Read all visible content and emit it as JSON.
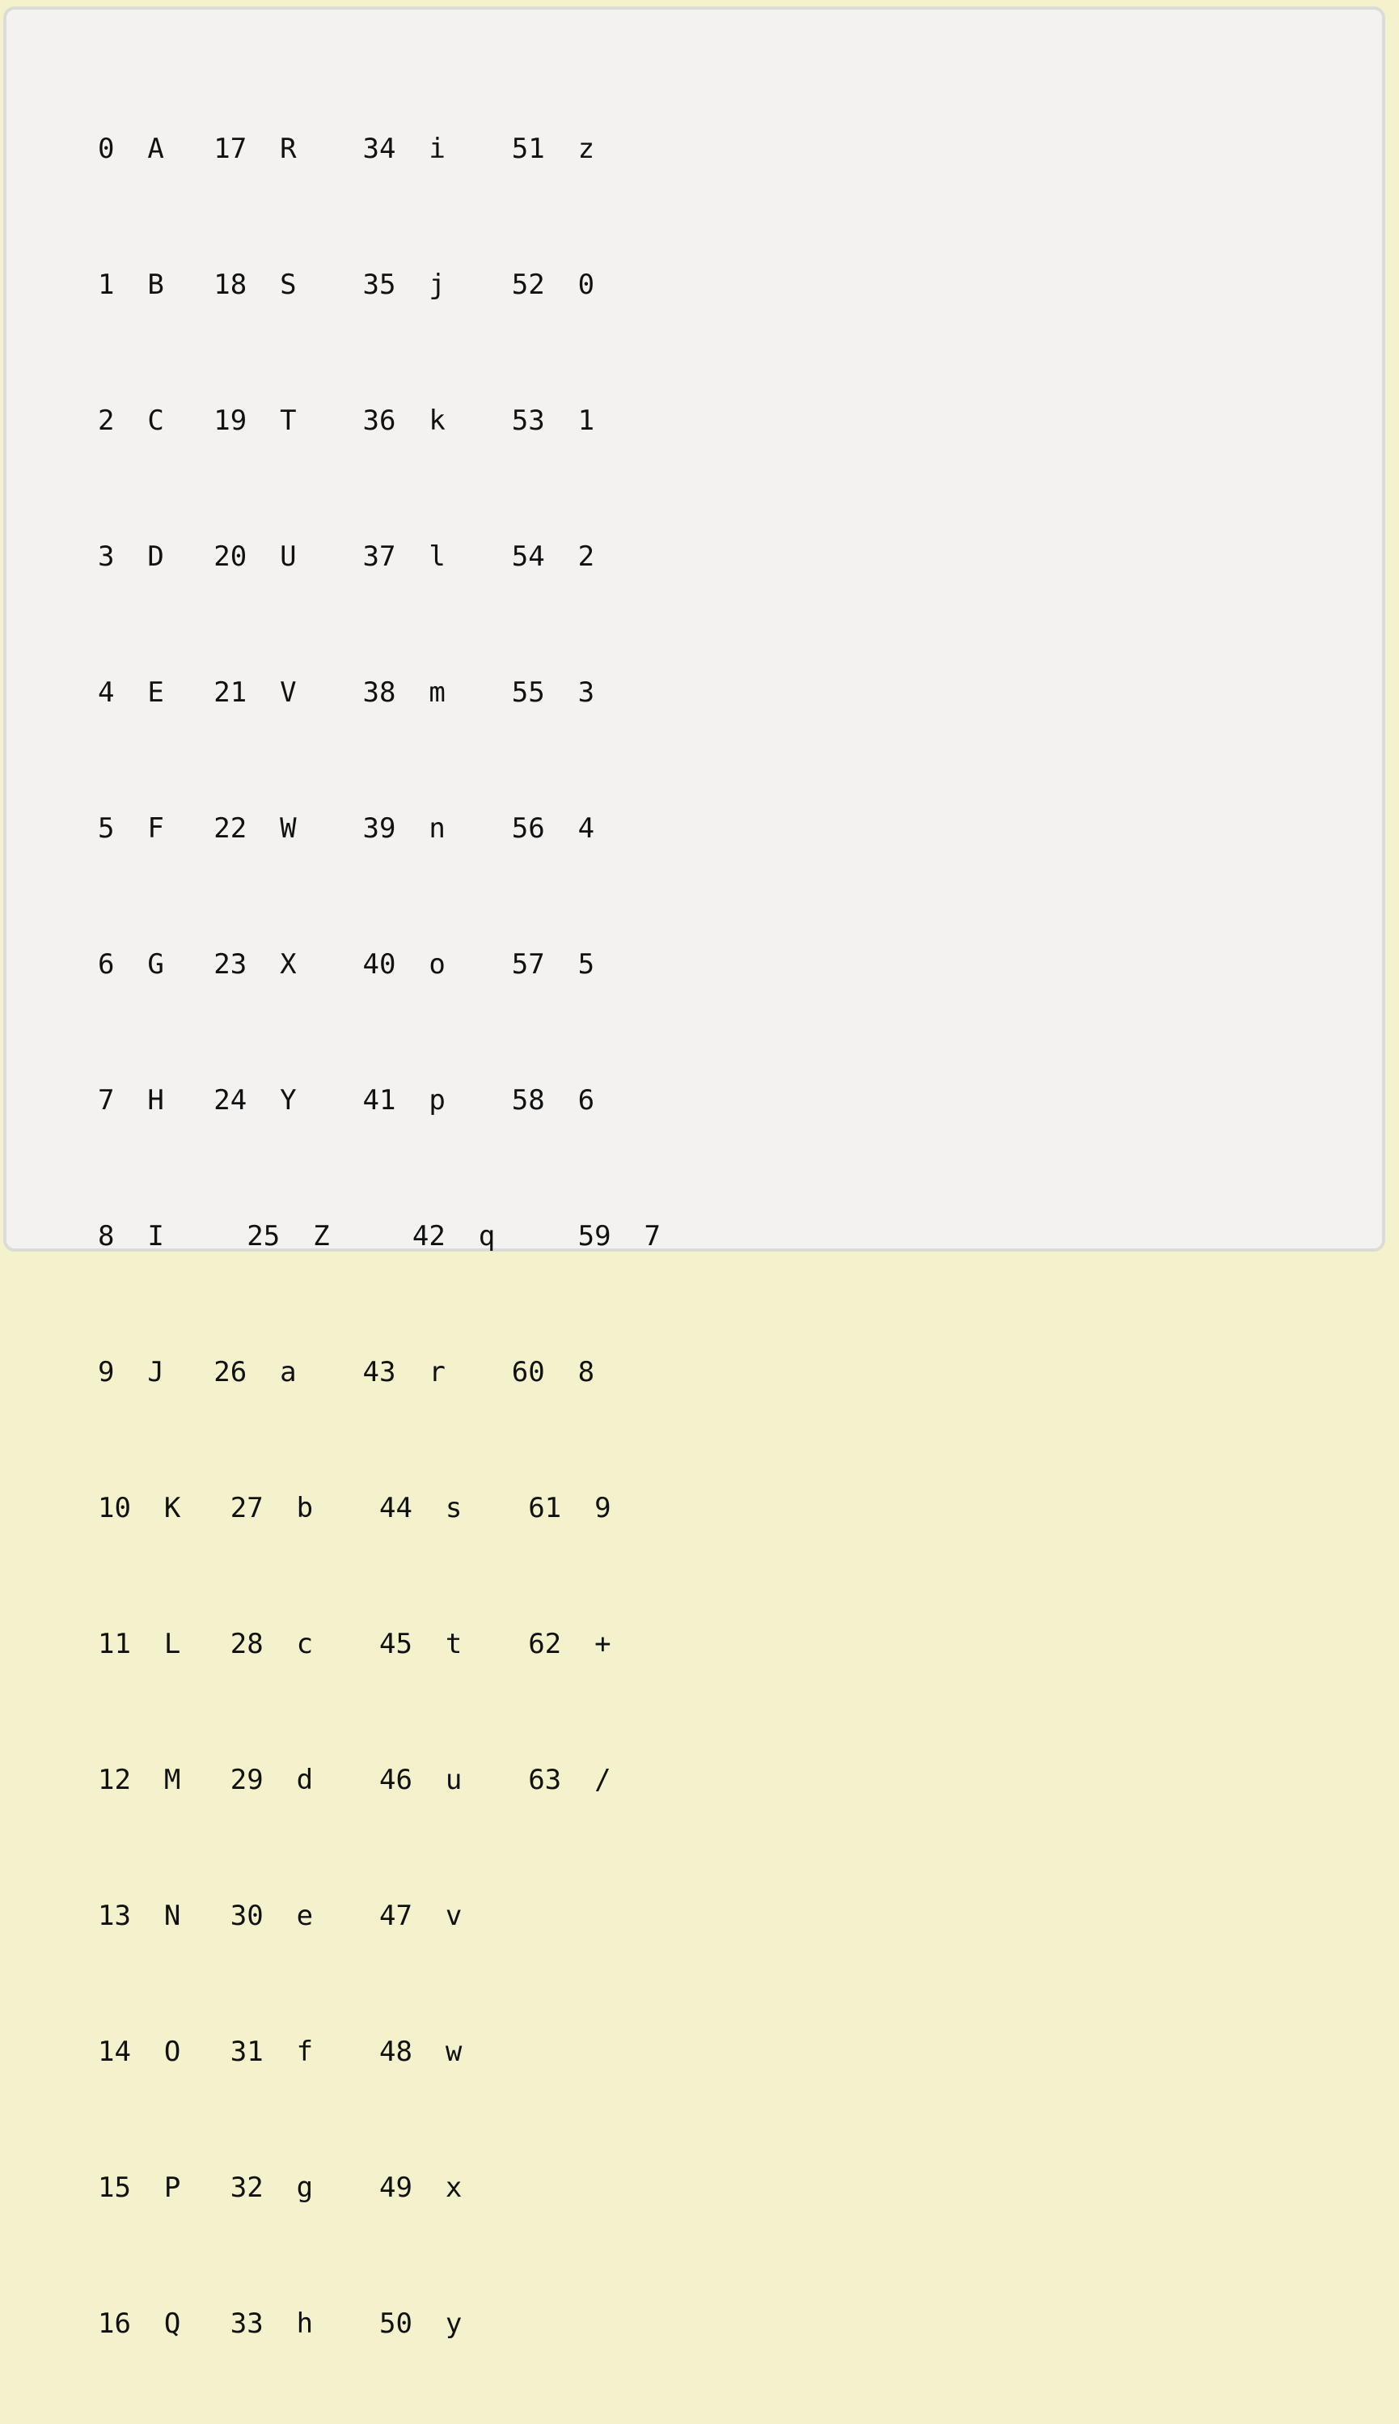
{
  "table": {
    "lines": [
      "0  A   17  R    34  i    51  z",
      "1  B   18  S    35  j    52  0",
      "2  C   19  T    36  k    53  1",
      "3  D   20  U    37  l    54  2",
      "4  E   21  V    38  m    55  3",
      "5  F   22  W    39  n    56  4",
      "6  G   23  X    40  o    57  5",
      "7  H   24  Y    41  p    58  6",
      "8  I     25  Z     42  q     59  7",
      "9  J   26  a    43  r    60  8",
      "10  K   27  b    44  s    61  9",
      "11  L   28  c    45  t    62  +",
      "12  M   29  d    46  u    63  /",
      "13  N   30  e    47  v",
      "14  O   31  f    48  w",
      "15  P   32  g    49  x",
      "16  Q   33  h    50  y"
    ]
  }
}
